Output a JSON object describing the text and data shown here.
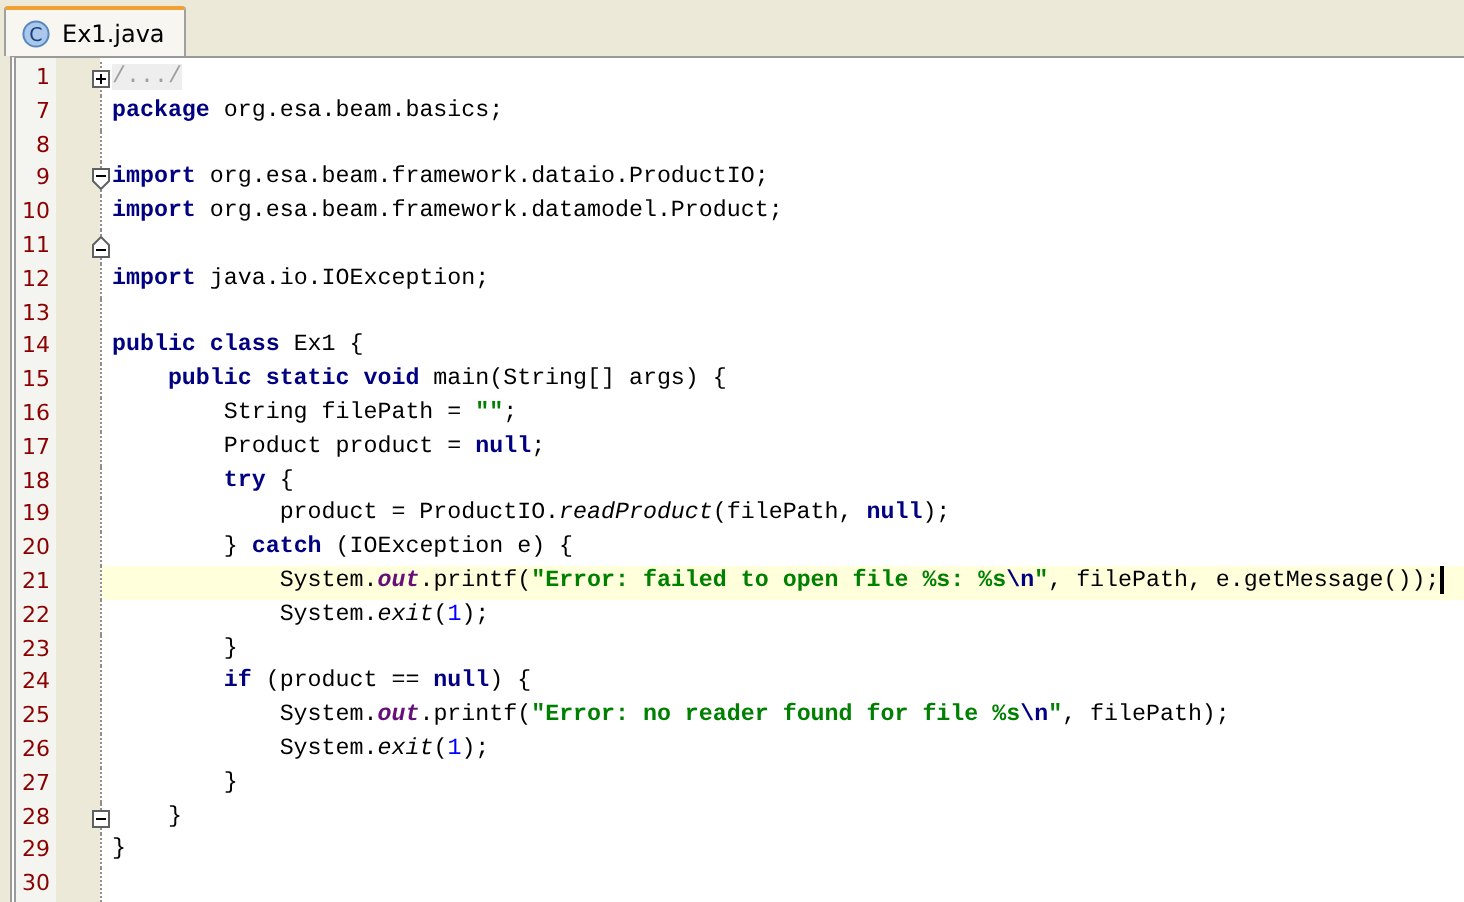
{
  "tabs": [
    {
      "label": "Ex1.java",
      "icon_letter": "C",
      "selected": true
    }
  ],
  "editor": {
    "lines": [
      {
        "number": "1",
        "fold": {
          "kind": "box",
          "expanded": false
        },
        "current": false,
        "segments": [
          {
            "kind": "comment",
            "text": "/.../"
          }
        ]
      },
      {
        "number": "7",
        "current": false,
        "segments": [
          {
            "kind": "kw",
            "text": "package"
          },
          {
            "kind": "plain",
            "text": " org.esa.beam.basics;"
          }
        ]
      },
      {
        "number": "8",
        "current": false
      },
      {
        "number": "9",
        "fold": {
          "kind": "start",
          "expanded": true
        },
        "current": false,
        "segments": [
          {
            "kind": "kw",
            "text": "import"
          },
          {
            "kind": "plain",
            "text": " org.esa.beam.framework.dataio.ProductIO;"
          }
        ]
      },
      {
        "number": "10",
        "current": false,
        "segments": [
          {
            "kind": "kw",
            "text": "import"
          },
          {
            "kind": "plain",
            "text": " org.esa.beam.framework.datamodel.Product;"
          }
        ]
      },
      {
        "number": "11",
        "fold": {
          "kind": "end",
          "expanded": true
        },
        "current": false
      },
      {
        "number": "12",
        "current": false,
        "segments": [
          {
            "kind": "kw",
            "text": "import"
          },
          {
            "kind": "plain",
            "text": " java.io.IOException;"
          }
        ]
      },
      {
        "number": "13",
        "current": false
      },
      {
        "number": "14",
        "current": false,
        "segments": [
          {
            "kind": "kw",
            "text": "public class"
          },
          {
            "kind": "plain",
            "text": " Ex1 {"
          }
        ]
      },
      {
        "number": "15",
        "current": false,
        "segments": [
          {
            "kind": "kw",
            "text": "    public static void"
          },
          {
            "kind": "plain",
            "text": " main(String[] args) {"
          }
        ]
      },
      {
        "number": "16",
        "current": false,
        "segments": [
          {
            "kind": "plain",
            "text": "        String filePath = "
          },
          {
            "kind": "str",
            "text": "\"\""
          },
          {
            "kind": "plain",
            "text": ";"
          }
        ]
      },
      {
        "number": "17",
        "current": false,
        "segments": [
          {
            "kind": "plain",
            "text": "        Product product = "
          },
          {
            "kind": "kw",
            "text": "null"
          },
          {
            "kind": "plain",
            "text": ";"
          }
        ]
      },
      {
        "number": "18",
        "current": false,
        "segments": [
          {
            "kind": "kw",
            "text": "        try"
          },
          {
            "kind": "plain",
            "text": " {"
          }
        ]
      },
      {
        "number": "19",
        "current": false,
        "segments": [
          {
            "kind": "plain",
            "text": "            product = ProductIO."
          },
          {
            "kind": "italic",
            "text": "readProduct"
          },
          {
            "kind": "plain",
            "text": "(filePath, "
          },
          {
            "kind": "kw",
            "text": "null"
          },
          {
            "kind": "plain",
            "text": ");"
          }
        ]
      },
      {
        "number": "20",
        "current": false,
        "segments": [
          {
            "kind": "plain",
            "text": "        } "
          },
          {
            "kind": "kw",
            "text": "catch"
          },
          {
            "kind": "plain",
            "text": " (IOException e) {"
          }
        ]
      },
      {
        "number": "21",
        "current": true,
        "segments": [
          {
            "kind": "plain",
            "text": "            System."
          },
          {
            "kind": "field",
            "text": "out"
          },
          {
            "kind": "plain",
            "text": ".printf("
          },
          {
            "kind": "str",
            "text": "\"Error: failed to open file %s: %s"
          },
          {
            "kind": "esc",
            "text": "\\n"
          },
          {
            "kind": "str",
            "text": "\""
          },
          {
            "kind": "plain",
            "text": ", filePath, e.getMessage());"
          }
        ]
      },
      {
        "number": "22",
        "current": false,
        "segments": [
          {
            "kind": "plain",
            "text": "            System."
          },
          {
            "kind": "italic",
            "text": "exit"
          },
          {
            "kind": "plain",
            "text": "("
          },
          {
            "kind": "num",
            "text": "1"
          },
          {
            "kind": "plain",
            "text": ");"
          }
        ]
      },
      {
        "number": "23",
        "current": false,
        "segments": [
          {
            "kind": "plain",
            "text": "        }"
          }
        ]
      },
      {
        "number": "24",
        "current": false,
        "segments": [
          {
            "kind": "kw",
            "text": "        if"
          },
          {
            "kind": "plain",
            "text": " (product == "
          },
          {
            "kind": "kw",
            "text": "null"
          },
          {
            "kind": "plain",
            "text": ") {"
          }
        ]
      },
      {
        "number": "25",
        "current": false,
        "segments": [
          {
            "kind": "plain",
            "text": "            System."
          },
          {
            "kind": "field",
            "text": "out"
          },
          {
            "kind": "plain",
            "text": ".printf("
          },
          {
            "kind": "str",
            "text": "\"Error: no reader found for file %s"
          },
          {
            "kind": "esc",
            "text": "\\n"
          },
          {
            "kind": "str",
            "text": "\""
          },
          {
            "kind": "plain",
            "text": ", filePath);"
          }
        ]
      },
      {
        "number": "26",
        "current": false,
        "segments": [
          {
            "kind": "plain",
            "text": "            System."
          },
          {
            "kind": "italic",
            "text": "exit"
          },
          {
            "kind": "plain",
            "text": "("
          },
          {
            "kind": "num",
            "text": "1"
          },
          {
            "kind": "plain",
            "text": ");"
          }
        ]
      },
      {
        "number": "27",
        "current": false,
        "segments": [
          {
            "kind": "plain",
            "text": "        }"
          }
        ]
      },
      {
        "number": "28",
        "fold": {
          "kind": "box",
          "expanded": true
        },
        "current": false,
        "segments": [
          {
            "kind": "plain",
            "text": "    }"
          }
        ]
      },
      {
        "number": "29",
        "current": false,
        "segments": [
          {
            "kind": "plain",
            "text": "}"
          }
        ]
      },
      {
        "number": "30",
        "current": false
      }
    ]
  }
}
